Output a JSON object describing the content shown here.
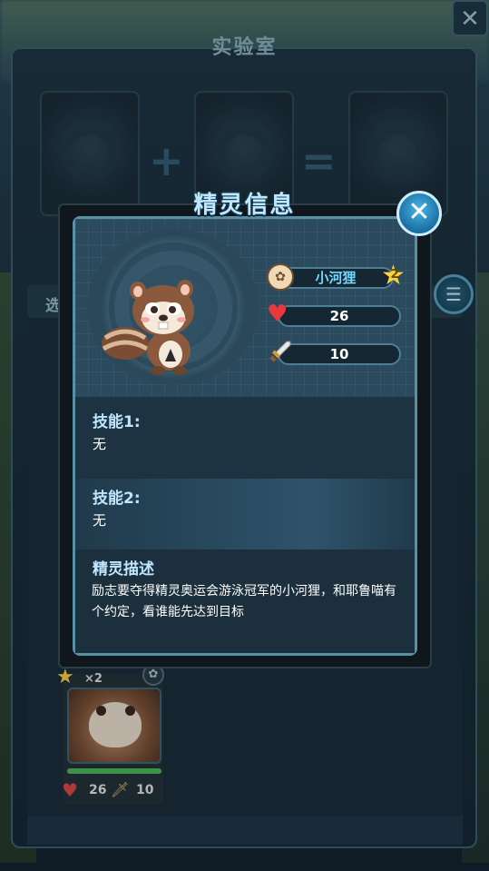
{
  "lab": {
    "title": "实验室",
    "close_label": "✕",
    "select_tab_label": "选",
    "plus_label": "+",
    "equals_label": "="
  },
  "card": {
    "star_count": "×2",
    "hp": "26",
    "attack": "10",
    "hp_fill": 1.0
  },
  "modal": {
    "title": "精灵信息",
    "close_label": "✕",
    "name": "小河狸",
    "star_level": "2",
    "hp": "26",
    "attack": "10",
    "skill1_label": "技能1:",
    "skill1_value": "无",
    "skill2_label": "技能2:",
    "skill2_value": "无",
    "desc_label": "精灵描述",
    "desc_text": "励志要夺得精灵奥运会游泳冠军的小河狸，和耶鲁喵有个约定，看谁能先达到目标"
  },
  "icons": {
    "close": "close-icon",
    "menu": "list-menu-icon",
    "paw": "paw-icon",
    "star": "star-icon",
    "heart": "heart-icon",
    "sword": "sword-icon"
  },
  "colors": {
    "name_text": "#6fd8ff",
    "heart": "#e8383c",
    "star": "#ffd23a",
    "modal_border": "#5a8fa8"
  }
}
